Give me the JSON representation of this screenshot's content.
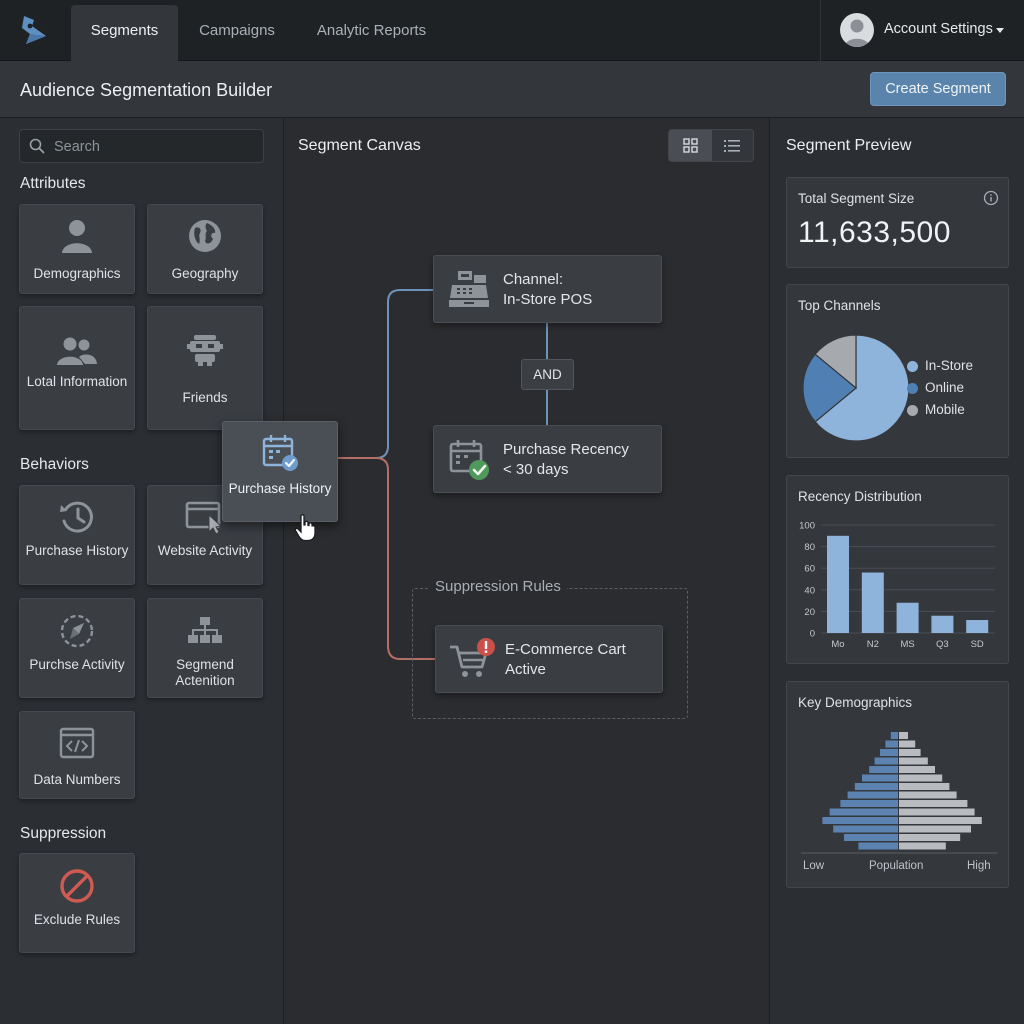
{
  "nav": {
    "tabs": [
      {
        "label": "Segments",
        "active": true
      },
      {
        "label": "Campaigns",
        "active": false
      },
      {
        "label": "Analytic Reports",
        "active": false
      }
    ],
    "account_label": "Account Settings"
  },
  "header": {
    "title": "Audience Segmentation Builder",
    "create_label": "Create Segment"
  },
  "sidebar": {
    "search_placeholder": "Search",
    "attributes_heading": "Attributes",
    "attributes": [
      {
        "label": "Demographics",
        "icon": "person-icon"
      },
      {
        "label": "Geography",
        "icon": "globe-icon"
      },
      {
        "label": "Lotal Information",
        "icon": "people-icon"
      },
      {
        "label": "Friends",
        "icon": "robot-icon"
      }
    ],
    "behaviors_heading": "Behaviors",
    "behaviors": [
      {
        "label": "Purchase History",
        "icon": "history-icon"
      },
      {
        "label": "Website Activity",
        "icon": "browser-cursor-icon"
      },
      {
        "label": "Purchse Activity",
        "icon": "compass-icon"
      },
      {
        "label": "Segmend Actenition",
        "icon": "hierarchy-icon"
      },
      {
        "label": "Data Numbers",
        "icon": "code-window-icon"
      }
    ],
    "suppression_heading": "Suppression",
    "suppression": [
      {
        "label": "Exclude Rules",
        "icon": "prohibited-icon"
      }
    ]
  },
  "canvas": {
    "title": "Segment Canvas",
    "drag_tile": {
      "label": "Purchase History"
    },
    "nodes": {
      "channel": {
        "line1": "Channel:",
        "line2": "In-Store POS"
      },
      "operator": "AND",
      "recency": {
        "line1": "Purchase Recency",
        "line2": "< 30 days"
      },
      "suppression_label": "Suppression Rules",
      "cart": {
        "line1": "E-Commerce Cart",
        "line2": "Active"
      }
    }
  },
  "preview": {
    "title": "Segment Preview",
    "total_label": "Total Segment Size",
    "total_value": "11,633,500",
    "channels_title": "Top Channels",
    "recency_title": "Recency Distribution",
    "demographics_title": "Key Demographics",
    "demo_axis": {
      "low": "Low",
      "mid": "Population",
      "high": "High"
    }
  },
  "chart_data": [
    {
      "type": "pie",
      "title": "Top Channels",
      "categories": [
        "In-Store",
        "Online",
        "Mobile"
      ],
      "values": [
        64,
        22,
        14
      ],
      "colors": [
        "#8fb4dc",
        "#4f7fb3",
        "#a6a9ad"
      ]
    },
    {
      "type": "bar",
      "title": "Recency Distribution",
      "categories": [
        "Mo",
        "N2",
        "MS",
        "Q3",
        "SD"
      ],
      "values": [
        90,
        56,
        28,
        16,
        12
      ],
      "ylim": [
        0,
        100
      ],
      "yticks": [
        0,
        20,
        40,
        60,
        80,
        100
      ],
      "color": "#8fb4dc"
    },
    {
      "type": "bar",
      "title": "Key Demographics",
      "orientation": "population-pyramid",
      "left_series": {
        "values": [
          0.04,
          0.07,
          0.1,
          0.13,
          0.16,
          0.2,
          0.24,
          0.28,
          0.32,
          0.38,
          0.42,
          0.36,
          0.3,
          0.22
        ],
        "color": "#5b82b0"
      },
      "right_series": {
        "values": [
          0.05,
          0.09,
          0.12,
          0.16,
          0.2,
          0.24,
          0.28,
          0.32,
          0.38,
          0.42,
          0.46,
          0.4,
          0.34,
          0.26
        ],
        "color": "#b8bcc1"
      },
      "xlabel": "Population",
      "x_range_labels": [
        "Low",
        "High"
      ]
    }
  ]
}
